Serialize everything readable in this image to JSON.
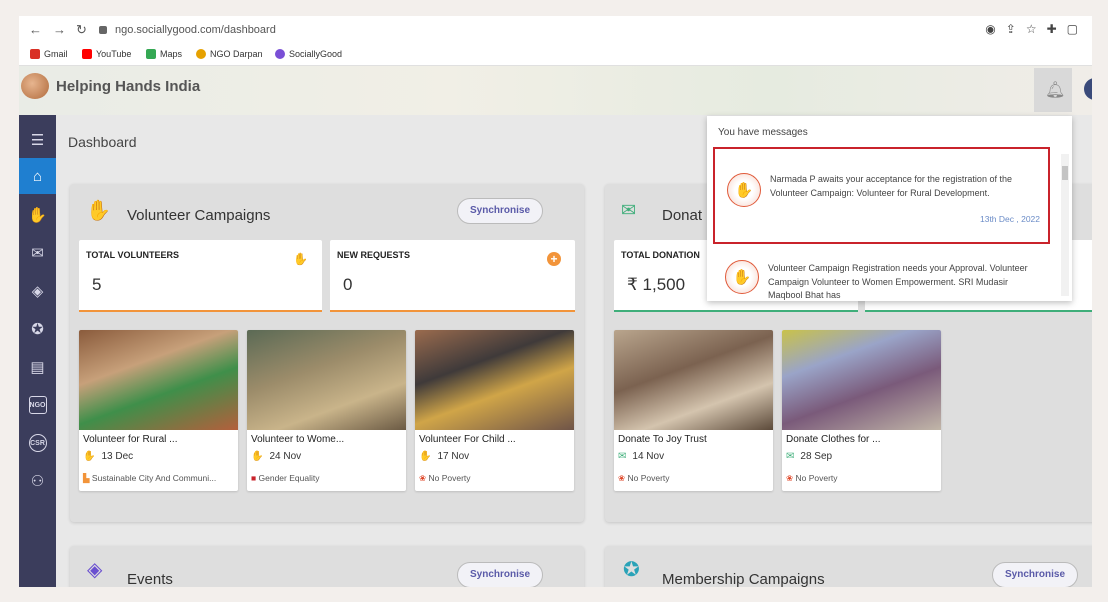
{
  "browser": {
    "url": "ngo.sociallygood.com/dashboard",
    "bookmarks": [
      {
        "label": "Gmail",
        "color": "#d93025"
      },
      {
        "label": "YouTube",
        "color": "#ff0000"
      },
      {
        "label": "Maps",
        "color": "#34a853"
      },
      {
        "label": "NGO Darpan",
        "color": "#e6a100"
      },
      {
        "label": "SociallyGood",
        "color": "#7a4fd6"
      }
    ]
  },
  "header": {
    "org_name": "Helping Hands India"
  },
  "sidebar": {
    "items": [
      {
        "icon": "menu-icon",
        "active": false
      },
      {
        "icon": "home-icon",
        "active": true
      },
      {
        "icon": "volunteer-hands-icon",
        "active": false
      },
      {
        "icon": "donation-icon",
        "active": false
      },
      {
        "icon": "events-icon",
        "active": false
      },
      {
        "icon": "membership-badge-icon",
        "active": false
      },
      {
        "icon": "contacts-book-icon",
        "active": false
      },
      {
        "icon": "ngo-building-icon",
        "active": false,
        "text": "NGO"
      },
      {
        "icon": "csr-icon",
        "active": false,
        "text": "CSR"
      },
      {
        "icon": "users-icon",
        "active": false
      }
    ]
  },
  "main": {
    "title": "Dashboard",
    "volunteer": {
      "title": "Volunteer Campaigns",
      "sync": "Synchronise",
      "stats": [
        {
          "label": "TOTAL VOLUNTEERS",
          "value": "5",
          "bar_color": "#f2943a"
        },
        {
          "label": "NEW REQUESTS",
          "value": "0",
          "bar_color": "#f2943a"
        }
      ],
      "cards": [
        {
          "title": "Volunteer for Rural ...",
          "date": "13 Dec",
          "tag": "Sustainable City And Communi...",
          "img": "linear-gradient(160deg,#8a5b3c 0%,#c7a07a 35%,#3f8f4a 60%,#b45f3c 100%)"
        },
        {
          "title": "Volunteer to Wome...",
          "date": "24 Nov",
          "tag": "Gender Equality",
          "img": "linear-gradient(160deg,#5b6a55 0%,#9c8c6a 40%,#c9b48a 70%,#6b5a44 100%)"
        },
        {
          "title": "Volunteer For Child ...",
          "date": "17 Nov",
          "tag": "No Poverty",
          "img": "linear-gradient(160deg,#9a6b4e 0%,#3f3a3a 35%,#d0a548 60%,#6f5448 100%)"
        }
      ]
    },
    "donation": {
      "title": "Donat",
      "stats": [
        {
          "label": "TOTAL DONATION",
          "value": "₹ 1,500",
          "bar_color": "#3fae7a"
        }
      ],
      "cards": [
        {
          "title": "Donate To Joy Trust",
          "date": "14 Nov",
          "tag": "No Poverty",
          "img": "linear-gradient(160deg,#b9a58d 0%,#7b6250 40%,#d4c4ae 70%,#5c4a3a 100%)"
        },
        {
          "title": "Donate Clothes for ...",
          "date": "28 Sep",
          "tag": "No Poverty",
          "img": "linear-gradient(160deg,#c9c24a 0%,#9aa4c8 30%,#7a5a7a 60%,#c1b6a8 100%)"
        }
      ]
    },
    "events": {
      "title": "Events",
      "sync": "Synchronise"
    },
    "membership": {
      "title": "Membership Campaigns",
      "sync": "Synchronise"
    }
  },
  "notifications": {
    "heading": "You have messages",
    "items": [
      {
        "text": "Narmada P awaits your acceptance for the registration of the Volunteer Campaign: Volunteer for Rural Development.",
        "date": "13th Dec , 2022",
        "selected": true
      },
      {
        "text": "Volunteer Campaign Registration needs your Approval. Volunteer Campaign Volunteer to Women Empowerment. SRI Mudasir Maqbool Bhat has",
        "date": "",
        "selected": false
      }
    ]
  }
}
